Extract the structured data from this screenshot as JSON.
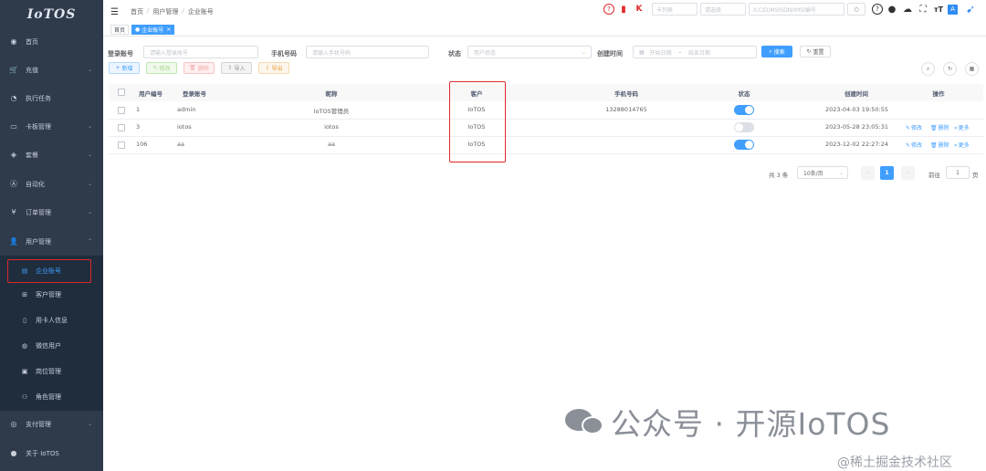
{
  "logo": "IoTOS",
  "sidebar": {
    "items": [
      {
        "label": "首页",
        "icon": "dashboard-icon",
        "arrow": false
      },
      {
        "label": "充值",
        "icon": "cart-icon",
        "arrow": true
      },
      {
        "label": "执行任务",
        "icon": "task-icon",
        "arrow": false
      },
      {
        "label": "卡板管理",
        "icon": "card-icon",
        "arrow": true
      },
      {
        "label": "套餐",
        "icon": "package-icon",
        "arrow": true
      },
      {
        "label": "自动化",
        "icon": "automation-icon",
        "arrow": true
      },
      {
        "label": "订单管理",
        "icon": "yen-icon",
        "arrow": true
      },
      {
        "label": "用户管理",
        "icon": "user-icon",
        "arrow": true
      }
    ],
    "sub_items": [
      {
        "label": "企业账号",
        "icon": "document-icon"
      },
      {
        "label": "客户管理",
        "icon": "org-icon"
      },
      {
        "label": "用卡人信息",
        "icon": "phone-icon"
      },
      {
        "label": "微信用户",
        "icon": "wechat-icon"
      },
      {
        "label": "岗位管理",
        "icon": "post-icon"
      },
      {
        "label": "角色管理",
        "icon": "role-icon"
      }
    ],
    "bottom_items": [
      {
        "label": "支付管理",
        "icon": "pay-icon",
        "arrow": true
      },
      {
        "label": "关于 IoTOS",
        "icon": "info-icon",
        "arrow": false
      }
    ]
  },
  "header": {
    "breadcrumb": [
      "首页",
      "用户管理",
      "企业账号"
    ],
    "card_select": "卡列表",
    "type_select": "请选择",
    "search_placeholder": "ICCID/MSISDN/IMSI编号"
  },
  "tags": [
    "首页",
    "企业账号"
  ],
  "form": {
    "login_label": "登录账号",
    "login_placeholder": "请输入登录账号",
    "phone_label": "手机号码",
    "phone_placeholder": "请输入手机号码",
    "status_label": "状态",
    "status_placeholder": "用户状态",
    "created_label": "创建时间",
    "start_placeholder": "开始日期",
    "end_placeholder": "结束日期",
    "date_sep": "-",
    "search_btn": "搜索",
    "reset_btn": "重置"
  },
  "toolbar": {
    "add": "新增",
    "edit": "修改",
    "delete": "删除",
    "import": "导入",
    "export": "导出"
  },
  "table": {
    "headers": [
      "用户编号",
      "登录账号",
      "昵称",
      "客户",
      "手机号码",
      "状态",
      "创建时间",
      "操作"
    ],
    "rows": [
      {
        "id": "1",
        "login": "admin",
        "nickname": "IoTOS管理员",
        "customer": "IoTOS",
        "phone": "13288014765",
        "status": true,
        "created": "2023-04-03 19:50:55",
        "ops": []
      },
      {
        "id": "3",
        "login": "iotos",
        "nickname": "iotos",
        "customer": "IoTOS",
        "phone": "",
        "status": false,
        "created": "2023-05-28 23:05:31",
        "ops": [
          "修改",
          "删除",
          "更多"
        ]
      },
      {
        "id": "106",
        "login": "aa",
        "nickname": "aa",
        "customer": "IoTOS",
        "phone": "",
        "status": true,
        "created": "2023-12-02 22:27:24",
        "ops": [
          "修改",
          "删除",
          "更多"
        ]
      }
    ]
  },
  "pagination": {
    "total": "共 3 条",
    "page_size": "10条/页",
    "current": "1",
    "goto_label": "前往",
    "goto_value": "1",
    "page_suffix": "页"
  },
  "watermark": {
    "main": "公众号 · 开源IoTOS",
    "sub": "@稀土掘金技术社区"
  },
  "colors": {
    "sidebar": "#2f3a4b",
    "accent": "#409eff",
    "highlight": "#e0292b"
  }
}
